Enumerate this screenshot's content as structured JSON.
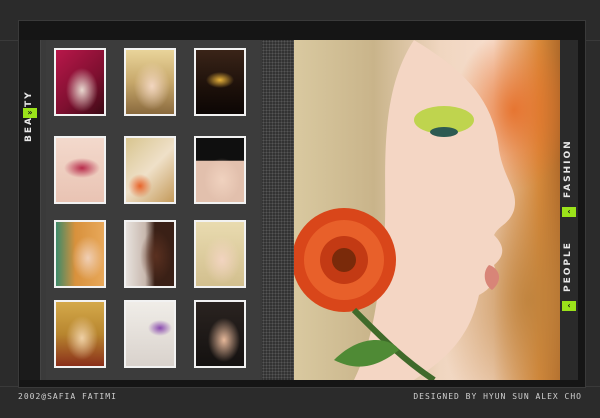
{
  "nav": {
    "beauty_label": "BEAUTY",
    "fashion_label": "FASHION",
    "people_label": "PEOPLE",
    "arrow_icon": "double-chevron-right-icon",
    "accent_color": "#9be31a"
  },
  "thumbnails": [
    {
      "name": "portrait-red-headwrap"
    },
    {
      "name": "portrait-blonde-dark-eyes"
    },
    {
      "name": "portrait-dark-gold-eye"
    },
    {
      "name": "portrait-pink-lips"
    },
    {
      "name": "portrait-green-eye-flower"
    },
    {
      "name": "portrait-dark-bangs"
    },
    {
      "name": "portrait-redhead-profile"
    },
    {
      "name": "portrait-dark-skin-profile"
    },
    {
      "name": "portrait-blonde-smile"
    },
    {
      "name": "portrait-yellow-makeup"
    },
    {
      "name": "portrait-feather-eyelash"
    },
    {
      "name": "portrait-dark-hair"
    }
  ],
  "footer": {
    "copyright": "2002@SAFIA FATIMI",
    "credit": "DESIGNED BY HYUN SUN ALEX CHO"
  }
}
